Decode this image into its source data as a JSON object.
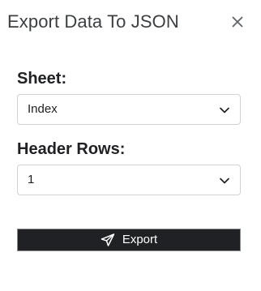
{
  "dialog": {
    "title": "Export Data To JSON",
    "close_icon": "close-icon"
  },
  "fields": {
    "sheet": {
      "label": "Sheet:",
      "selected": "Index",
      "icon": "chevron-down-icon"
    },
    "header_rows": {
      "label": "Header Rows:",
      "selected": "1",
      "icon": "chevron-down-icon"
    }
  },
  "actions": {
    "export_label": "Export",
    "export_icon": "send-icon",
    "button_color": "#202124"
  }
}
